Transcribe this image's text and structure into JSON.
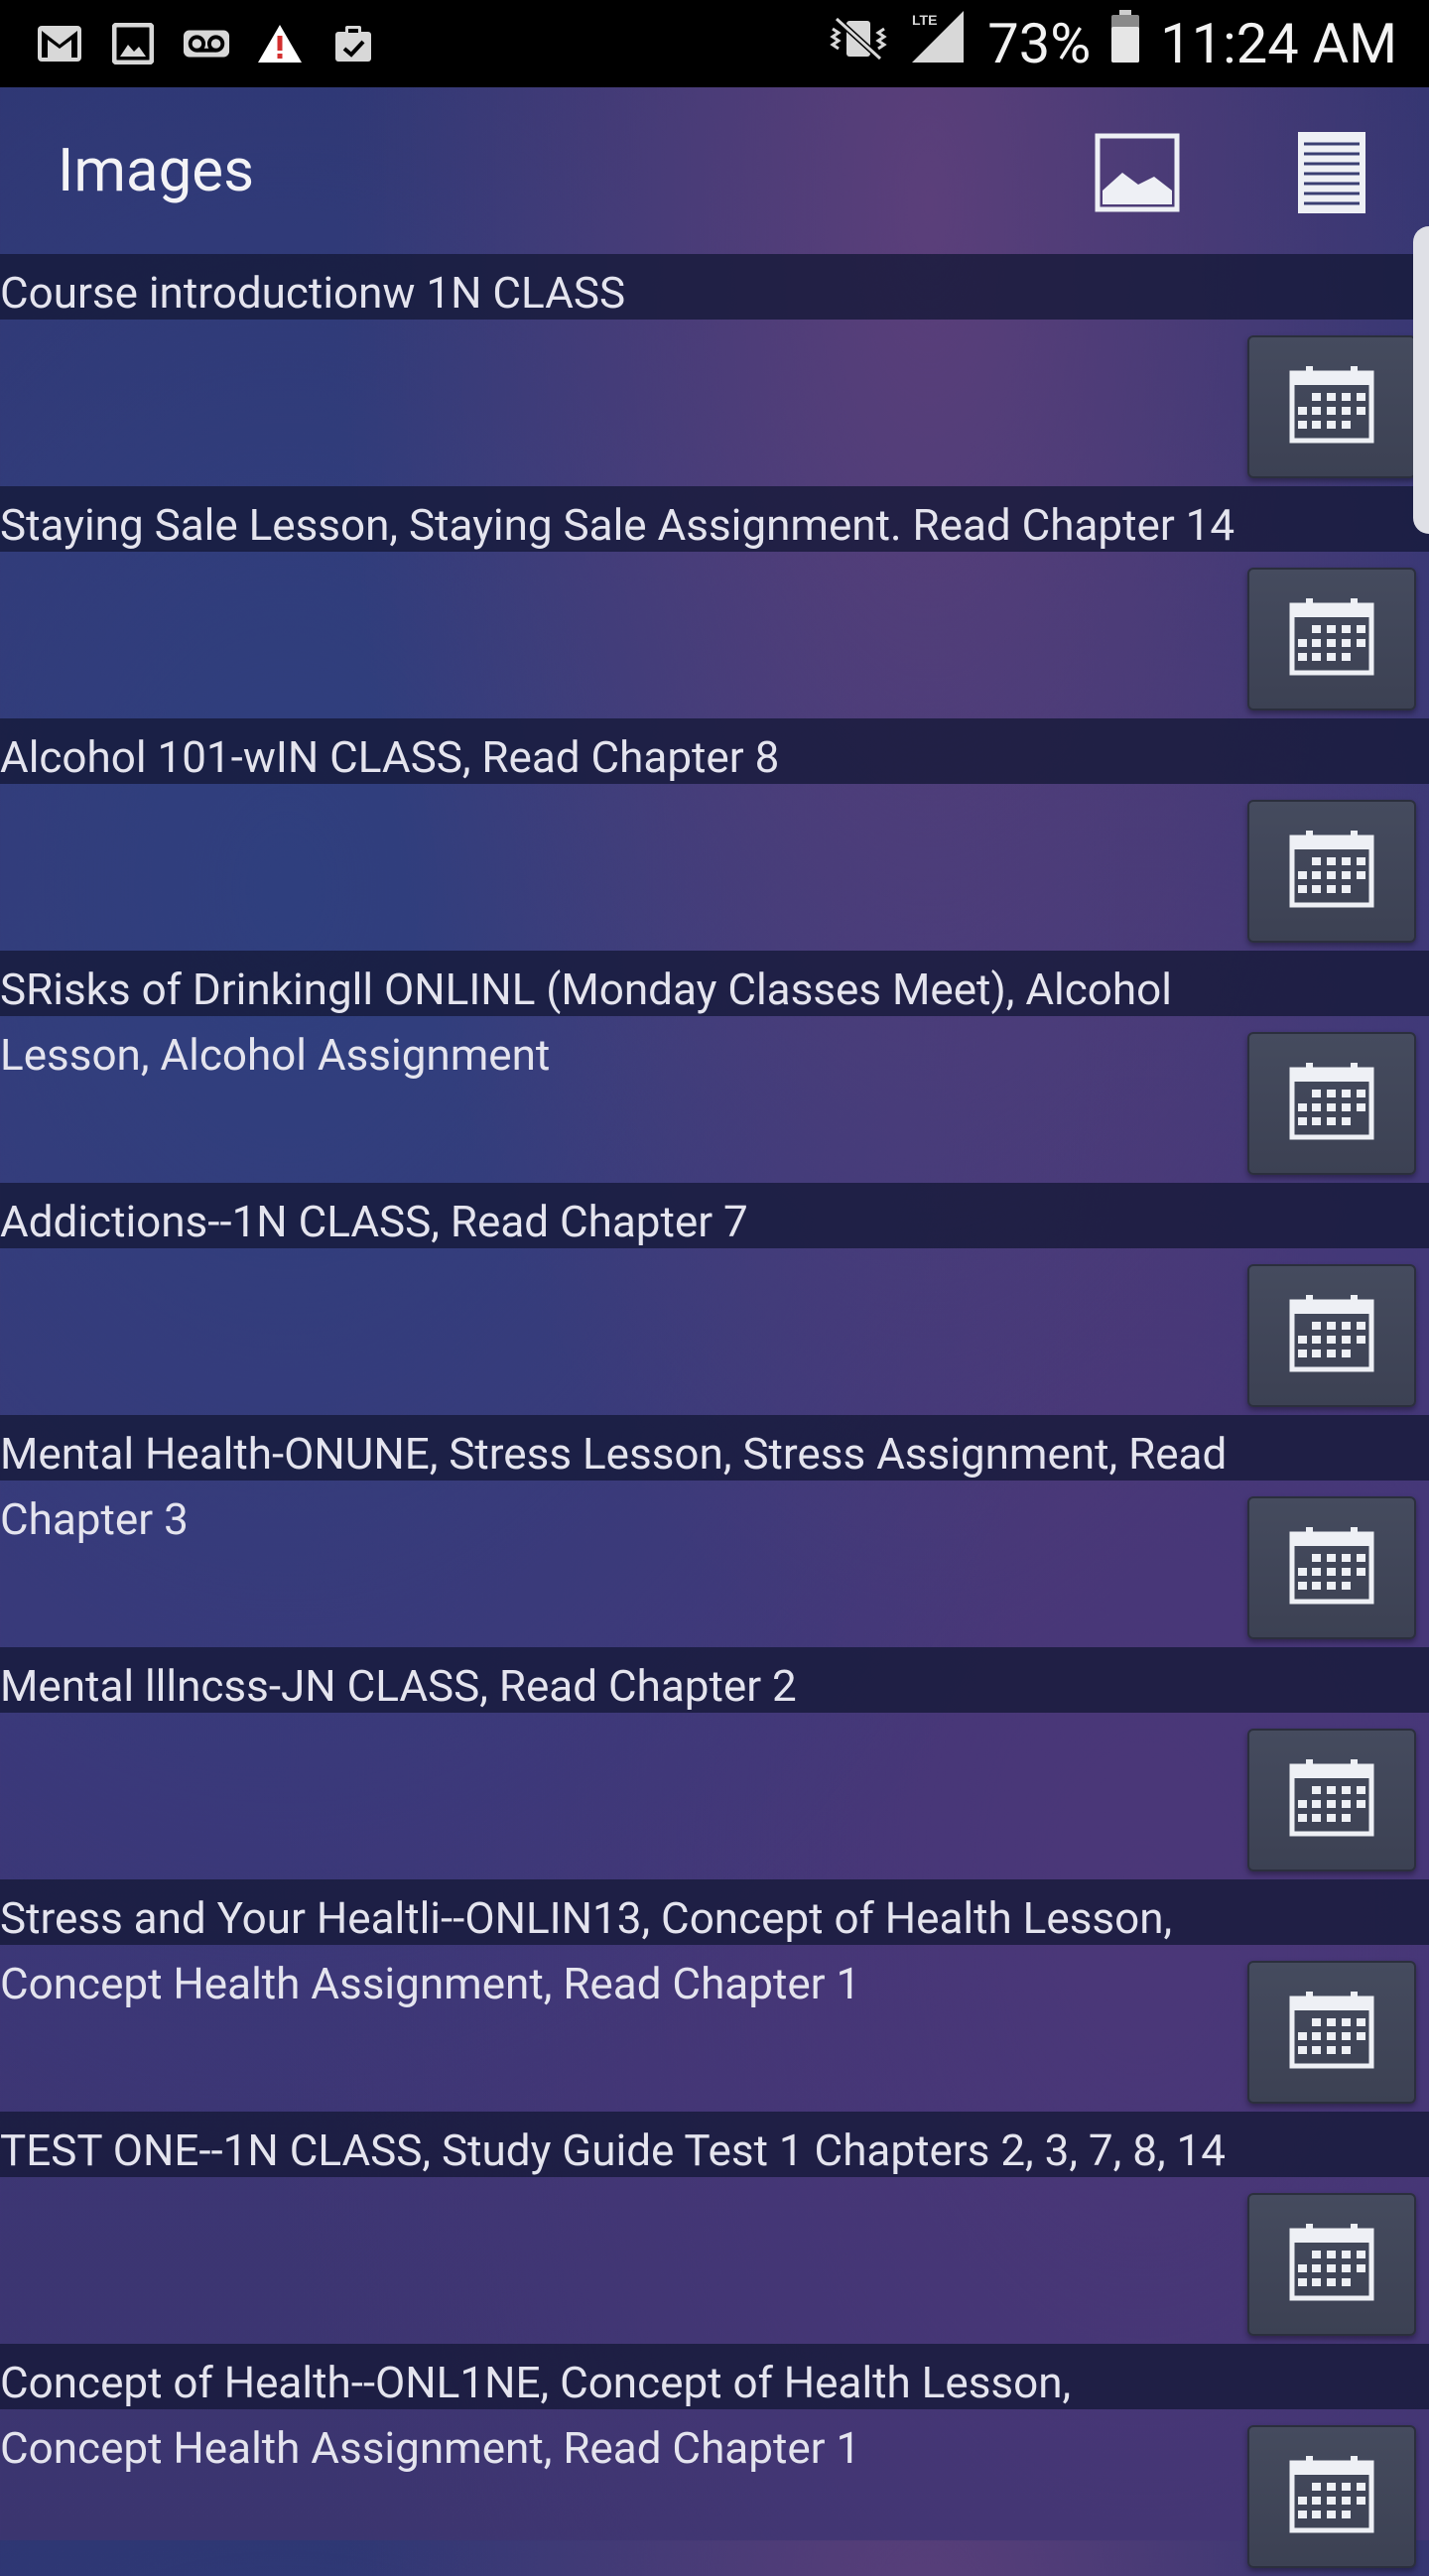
{
  "status_bar": {
    "icons": [
      "gmail-icon",
      "gallery-icon",
      "voicemail-icon",
      "warning-icon",
      "clipboard-icon"
    ],
    "battery": "73%",
    "time": "11:24 AM",
    "network": "LTE"
  },
  "app_bar": {
    "title": "Images",
    "image_button_icon": "image-icon",
    "list_button_icon": "list-icon"
  },
  "items": [
    {
      "text": "Course introductionw 1N CLASS"
    },
    {
      "text": "Staying Sale Lesson, Staying Sale Assignment. Read Chapter 14"
    },
    {
      "text": "Alcohol 101-wIN CLASS, Read Chapter 8"
    },
    {
      "text": "SRisks of Drinkingll ONLINL (Monday Classes Meet), Alcohol Lesson, Alcohol Assignment"
    },
    {
      "text": "Addictions--1N CLASS, Read Chapter 7"
    },
    {
      "text": "Mental Health-ONUNE, Stress Lesson, Stress Assignment, Read Chapter 3"
    },
    {
      "text": "Mental lllncss-JN CLASS, Read Chapter 2"
    },
    {
      "text": "Stress and Your Healtli--ONLIN13, Concept of Health Lesson, Concept Health Assignment, Read Chapter 1"
    },
    {
      "text": "TEST ONE--1N CLASS, Study Guide Test 1 Chapters 2, 3, 7, 8, 14"
    },
    {
      "text": "Concept of Health--ONL1NE, Concept of Health Lesson, Concept Health Assignment, Read Chapter 1"
    }
  ],
  "colors": {
    "status_bar_bg": "#000000",
    "title_band": "#14183a",
    "calendar_button": "#454b5e",
    "text": "#e4e4ee"
  }
}
